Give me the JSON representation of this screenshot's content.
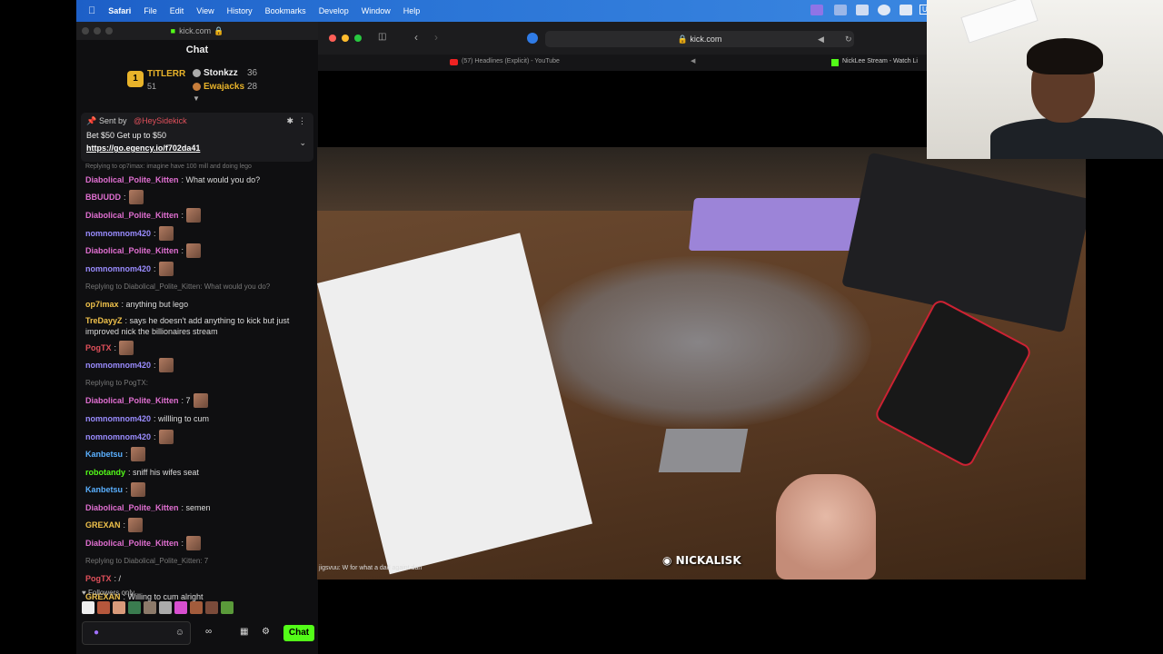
{
  "menubar": {
    "app": "Safari",
    "items": [
      "File",
      "Edit",
      "View",
      "History",
      "Bookmarks",
      "Develop",
      "Window",
      "Help"
    ],
    "input_source": "US"
  },
  "chat": {
    "window_url": "kick.com",
    "heading": "Chat",
    "leaderboard": {
      "rank": "1",
      "top_user": "TITLERR",
      "top_count": "51",
      "second_user": "Stonkzz",
      "second_count": "36",
      "third_user": "Ewajacks",
      "third_count": "28"
    },
    "pinned": {
      "sent_by_label": "Sent by",
      "sender": "@HeySidekick",
      "line1": "Bet $50 Get up to $50",
      "link": "https://go.egency.io/f702da41",
      "reply_preview": "Replying to op7imax: imagine have 100 mill and doing lego"
    },
    "messages": [
      {
        "user": "Diabolical_Polite_Kitten",
        "color": "#e06fd1",
        "text": ": What would you do?"
      },
      {
        "user": "BBUUDD",
        "color": "#e06fd1",
        "text": ":"
      },
      {
        "user": "Diabolical_Polite_Kitten",
        "color": "#e06fd1",
        "text": ":"
      },
      {
        "user": "nomnomnom420",
        "color": "#9a8cff",
        "text": ":"
      },
      {
        "user": "Diabolical_Polite_Kitten",
        "color": "#e06fd1",
        "text": ":"
      },
      {
        "user": "nomnomnom420",
        "color": "#9a8cff",
        "text": ":"
      },
      {
        "reply": "Replying to Diabolical_Polite_Kitten: What would you do?"
      },
      {
        "user": "op7imax",
        "color": "#f0c24b",
        "text": ": anything but lego"
      },
      {
        "user": "TreDayyZ",
        "color": "#f0c24b",
        "text": ": says he doesn't add anything to kick but just improved nick the billionaires stream",
        "two": true
      },
      {
        "user": "PogTX",
        "color": "#e0505b",
        "text": ":"
      },
      {
        "user": "nomnomnom420",
        "color": "#9a8cff",
        "text": ":"
      },
      {
        "reply": "Replying to PogTX:"
      },
      {
        "user": "Diabolical_Polite_Kitten",
        "color": "#e06fd1",
        "text": ": 7"
      },
      {
        "user": "nomnomnom420",
        "color": "#9a8cff",
        "text": ": willling to cum"
      },
      {
        "user": "nomnomnom420",
        "color": "#9a8cff",
        "text": ":"
      },
      {
        "user": "Kanbetsu",
        "color": "#5ab0ff",
        "text": ":"
      },
      {
        "user": "robotandy",
        "color": "#53fc18",
        "text": ": sniff his wifes seat"
      },
      {
        "user": "Kanbetsu",
        "color": "#5ab0ff",
        "text": ":"
      },
      {
        "user": "Diabolical_Polite_Kitten",
        "color": "#e06fd1",
        "text": ": semen"
      },
      {
        "user": "GREXAN",
        "color": "#f0c24b",
        "text": ":"
      },
      {
        "user": "Diabolical_Polite_Kitten",
        "color": "#e06fd1",
        "text": ":"
      },
      {
        "reply": "Replying to Diabolical_Polite_Kitten: 7"
      },
      {
        "user": "PogTX",
        "color": "#e0505b",
        "text": ": /"
      },
      {
        "user": "GREXAN",
        "color": "#f0c24b",
        "text": ": Willing to cum alright"
      }
    ],
    "followers_only": "Followers only",
    "chat_button": "Chat"
  },
  "safari": {
    "url": "kick.com",
    "tabs": [
      {
        "label": "(57) Headlines (Explicit) - YouTube"
      },
      {
        "label": "NickLee Stream - Watch Li"
      }
    ]
  },
  "video": {
    "streamer_tag": "NICKALISK",
    "subtitle": "jigsvuu: W for what a dad againt dan"
  }
}
